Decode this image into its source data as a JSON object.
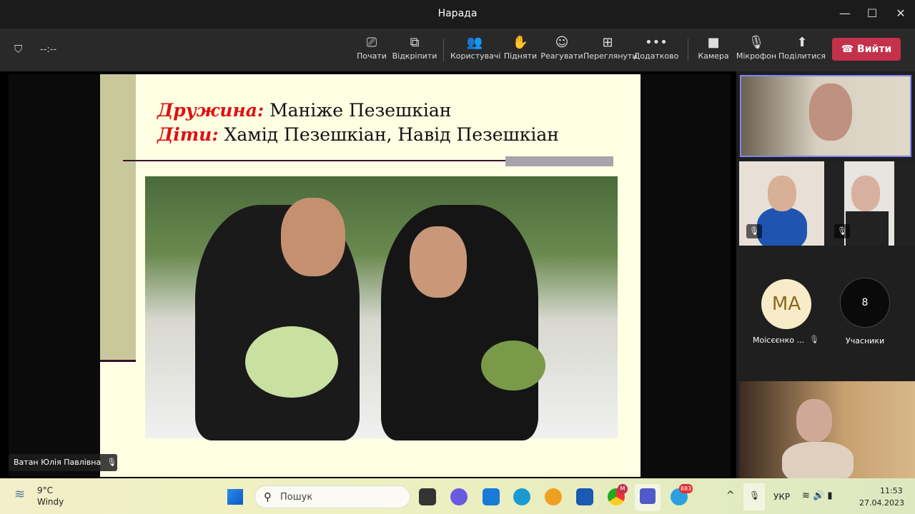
{
  "window": {
    "title": "Нарада",
    "minimize": "—",
    "maximize": "☐",
    "close": "✕"
  },
  "toolbar": {
    "timer": "--:--",
    "buttons": [
      {
        "label": "Почати",
        "icon": "start-share-icon",
        "glyph": "⎚"
      },
      {
        "label": "Відкріпити",
        "icon": "pop-out-icon",
        "glyph": "⧉"
      },
      {
        "label": "Користувачі",
        "icon": "people-icon",
        "glyph": "👥"
      },
      {
        "label": "Підняти",
        "icon": "raise-hand-icon",
        "glyph": "✋"
      },
      {
        "label": "Реагувати",
        "icon": "smiley-icon",
        "glyph": "☺"
      },
      {
        "label": "Переглянути",
        "icon": "view-grid-icon",
        "glyph": "⊞"
      },
      {
        "label": "Додатково",
        "icon": "more-icon",
        "glyph": "•••"
      },
      {
        "label": "Камера",
        "icon": "camera-icon",
        "glyph": "■"
      },
      {
        "label": "Мікрофон",
        "icon": "mic-off-icon",
        "glyph": "🎙"
      },
      {
        "label": "Поділитися",
        "icon": "share-icon",
        "glyph": "⬆"
      }
    ],
    "leave": "Вийти",
    "leave_color": "#c4314b"
  },
  "slide": {
    "line1_label": "Дружина:",
    "line1_text": " Маніже Пезешкіан",
    "line2_label": "Діти:",
    "line2_text": " Хамід Пезешкіан, Навід Пезешкіан"
  },
  "presenter": {
    "name": "Ватан Юлія Павлівна"
  },
  "participants": {
    "avatar_initials": "MA",
    "avatar_name": "Мoіcєєнко ...",
    "count": "8",
    "count_label": "Учасники"
  },
  "taskbar": {
    "weather_temp": "9°C",
    "weather_desc": "Windy",
    "search_placeholder": "Пошук",
    "telegram_badge": "883",
    "chrome_badge": "M",
    "language": "УКР",
    "time": "11:53",
    "date": "27.04.2023"
  }
}
